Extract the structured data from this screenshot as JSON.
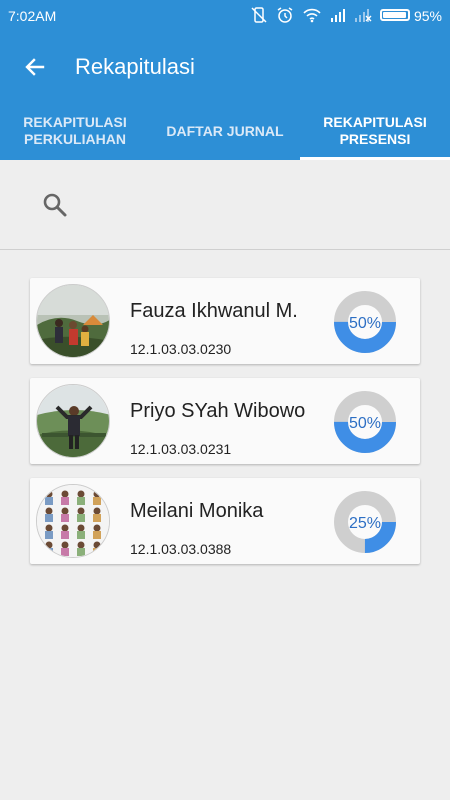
{
  "status_bar": {
    "time": "7:02AM",
    "battery": "95%",
    "icons": [
      "vibrate-off-icon",
      "alarm-icon",
      "wifi-icon",
      "signal-icon",
      "signal-off-icon",
      "battery-icon"
    ]
  },
  "app_bar": {
    "title": "Rekapitulasi",
    "back_icon": "arrow-left-icon"
  },
  "tabs": [
    {
      "label": "REKAPITULASI\nPERKULIAHAN",
      "active": false
    },
    {
      "label": "DAFTAR JURNAL",
      "active": false
    },
    {
      "label": "REKAPITULASI\nPRESENSI",
      "active": true
    }
  ],
  "search": {
    "icon": "search-icon"
  },
  "students": [
    {
      "name": "Fauza Ikhwanul M.",
      "nim": "12.1.03.03.0230",
      "percent_label": "50%",
      "percent": 50
    },
    {
      "name": "Priyo SYah Wibowo",
      "nim": "12.1.03.03.0231",
      "percent_label": "50%",
      "percent": 50
    },
    {
      "name": "Meilani Monika",
      "nim": "12.1.03.03.0388",
      "percent_label": "25%",
      "percent": 25
    }
  ],
  "colors": {
    "primary": "#2d8fd6",
    "donut_fill": "#3f8ee6",
    "donut_track": "#cfcfcf",
    "background": "#eeeeee"
  }
}
